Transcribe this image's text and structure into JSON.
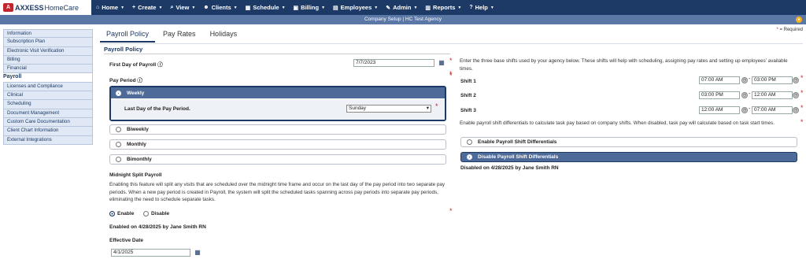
{
  "brand": {
    "mark": "A",
    "name_a": "AXXESS",
    "name_b": "HomeCare"
  },
  "nav": [
    {
      "icon": "⌂",
      "label": "Home"
    },
    {
      "icon": "+",
      "label": "Create"
    },
    {
      "icon": "⌕",
      "label": "View"
    },
    {
      "icon": "☻",
      "label": "Clients"
    },
    {
      "icon": "▦",
      "label": "Schedule"
    },
    {
      "icon": "▣",
      "label": "Billing"
    },
    {
      "icon": "▤",
      "label": "Employees"
    },
    {
      "icon": "✎",
      "label": "Admin"
    },
    {
      "icon": "▥",
      "label": "Reports"
    },
    {
      "icon": "?",
      "label": "Help"
    }
  ],
  "subbar": {
    "text": "Company Setup | HC Test Agency"
  },
  "required": {
    "star": "*",
    "text": "= Required"
  },
  "sidebar": [
    "Information",
    "Subscription Plan",
    "Electronic Visit Verification",
    "Billing",
    "Financial",
    "Payroll",
    "Licenses and Compliance",
    "Clinical",
    "Scheduling",
    "Document Management",
    "Custom Care Documentation",
    "Client Chart Information",
    "External Integrations"
  ],
  "tabs": [
    "Payroll Policy",
    "Pay Rates",
    "Holidays"
  ],
  "section_title": "Payroll Policy",
  "first_day": {
    "label": "First Day of Payroll",
    "value": "7/7/2023"
  },
  "pay_period": {
    "label": "Pay Period",
    "options": [
      "Weekly",
      "Biweekly",
      "Monthly",
      "Bimonthly"
    ],
    "last_day_label": "Last Day of the Pay Period.",
    "last_day_value": "Sunday"
  },
  "midnight": {
    "title": "Midnight Split Payroll",
    "text": "Enabling this feature will split any visits that are scheduled over the midnight time frame and occur on the last day of the pay period into two separate pay periods. When a new pay period is created in Payroll, the system will split the scheduled tasks spanning across pay periods into separate pay periods, eliminating the need to schedule separate tasks.",
    "enable": "Enable",
    "disable": "Disable",
    "enabled_on": "Enabled on 4/28/2025 by Jane Smith RN"
  },
  "effective": {
    "label": "Effective Date",
    "value": "4/1/2025"
  },
  "shifts": {
    "intro": "Enter the three base shifts used by your agency below. These shifts will help with scheduling, assigning pay rates and setting up employees' available times.",
    "rows": [
      {
        "label": "Shift 1",
        "start": "07:00 AM",
        "end": "03:00 PM"
      },
      {
        "label": "Shift 2",
        "start": "03:00 PM",
        "end": "12:00 AM"
      },
      {
        "label": "Shift 3",
        "start": "12:00 AM",
        "end": "07:00 AM"
      }
    ],
    "diff_text": "Enable payroll shift differentials to calculate task pay based on company shifts. When disabled, task pay will calculate based on task start times.",
    "enable_label": "Enable Payroll Shift Differentials",
    "disable_label": "Disable Payroll Shift Differentials",
    "disabled_on": "Disabled on 4/28/2025 by Jane Smith RN"
  }
}
